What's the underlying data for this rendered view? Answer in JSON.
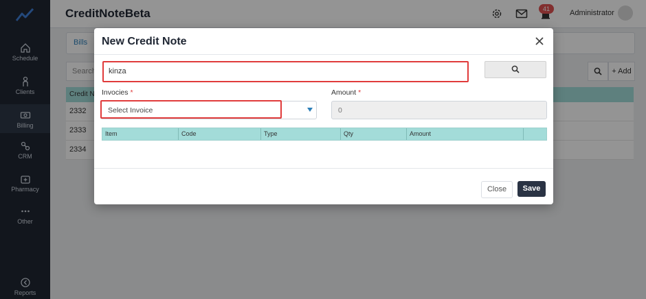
{
  "app": {
    "title": "CreditNoteBeta",
    "user": "Administrator",
    "notification_count": "41"
  },
  "sidebar": {
    "items": [
      {
        "label": "Schedule",
        "icon": "home-icon"
      },
      {
        "label": "Clients",
        "icon": "user-icon"
      },
      {
        "label": "Billing",
        "icon": "money-icon",
        "active": true
      },
      {
        "label": "CRM",
        "icon": "crm-icon"
      },
      {
        "label": "Pharmacy",
        "icon": "pharmacy-icon"
      },
      {
        "label": "Other",
        "icon": "more-icon"
      },
      {
        "label": "Reports",
        "icon": "reports-icon"
      }
    ]
  },
  "background": {
    "tab": "Bills",
    "search_placeholder": "Search",
    "add_label": "+ Add",
    "table_header": "Credit N",
    "rows": [
      "2332",
      "2333",
      "2334"
    ]
  },
  "modal": {
    "title": "New Credit Note",
    "client_value": "kinza",
    "invoices_label": "Invocies",
    "invoice_placeholder": "Select Invoice",
    "amount_label": "Amount",
    "amount_value": "0",
    "required_mark": "*",
    "table_columns": [
      "Item",
      "Code",
      "Type",
      "Qty",
      "Amount"
    ],
    "close_label": "Close",
    "save_label": "Save"
  },
  "colors": {
    "accent": "#2c7fb8",
    "highlight": "#e03a3a",
    "table_header": "#a3dcd9",
    "sidebar": "#1f2633"
  }
}
